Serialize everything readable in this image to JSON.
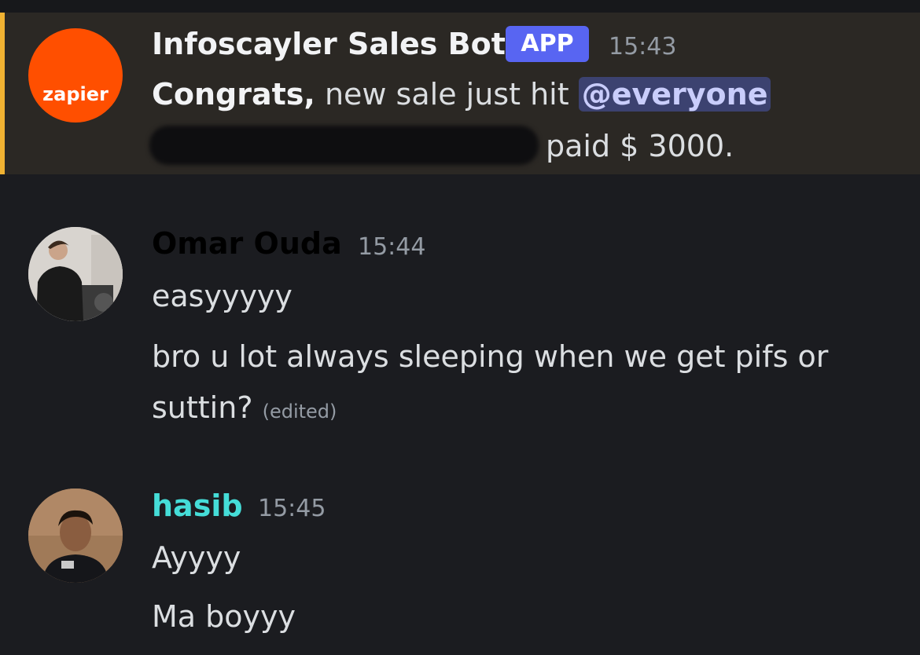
{
  "messages": [
    {
      "username": "Infoscayler Sales Bot",
      "badge": "APP",
      "time": "15:43",
      "avatar_text": "zapier",
      "line1": {
        "bold": "Congrats,",
        "text": " new sale just hit ",
        "mention": "@everyone"
      },
      "line2": "paid $ 3000."
    },
    {
      "username": "Omar Ouda",
      "time": "15:44",
      "lines": [
        "easyyyyy",
        "bro u lot always sleeping when we get pifs or",
        "suttin?"
      ],
      "edited": "(edited)"
    },
    {
      "username": "hasib",
      "time": "15:45",
      "lines": [
        "Ayyyy",
        "Ma boyyy"
      ]
    }
  ],
  "colors": {
    "background": "#1b1c20",
    "highlight": "#2b2824",
    "highlight_bar": "#f0b232",
    "app_badge": "#5865f2",
    "mention_bg": "#3c4270",
    "hasib_name": "#45ddd8",
    "omar_name": "#000000"
  }
}
